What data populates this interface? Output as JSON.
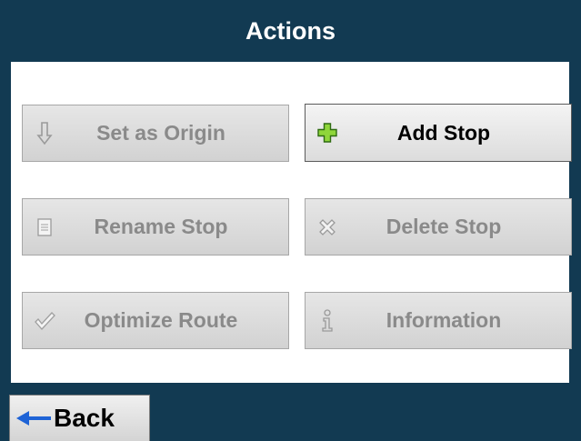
{
  "title": "Actions",
  "buttons": {
    "set_origin": {
      "label": "Set as Origin",
      "icon": "arrow-down-icon"
    },
    "add_stop": {
      "label": "Add Stop",
      "icon": "plus-icon"
    },
    "rename_stop": {
      "label": "Rename Stop",
      "icon": "document-icon"
    },
    "delete_stop": {
      "label": "Delete Stop",
      "icon": "x-icon"
    },
    "optimize_route": {
      "label": "Optimize Route",
      "icon": "checkmark-icon"
    },
    "information": {
      "label": "Information",
      "icon": "info-icon"
    }
  },
  "back": {
    "label": "Back",
    "icon": "arrow-left-icon"
  },
  "colors": {
    "background": "#123a52",
    "accent_blue": "#1e63d6",
    "plus_green": "#8fd63a"
  }
}
